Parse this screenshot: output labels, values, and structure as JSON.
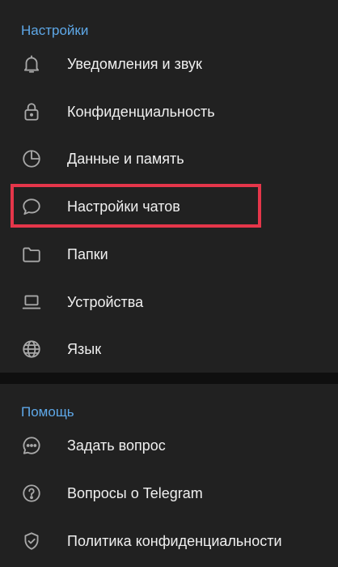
{
  "settings": {
    "header": "Настройки",
    "items": [
      {
        "label": "Уведомления и звук",
        "icon": "bell-icon"
      },
      {
        "label": "Конфиденциальность",
        "icon": "lock-icon"
      },
      {
        "label": "Данные и память",
        "icon": "pie-chart-icon"
      },
      {
        "label": "Настройки чатов",
        "icon": "chat-bubble-icon"
      },
      {
        "label": "Папки",
        "icon": "folder-icon"
      },
      {
        "label": "Устройства",
        "icon": "laptop-icon"
      },
      {
        "label": "Язык",
        "icon": "globe-icon"
      }
    ]
  },
  "help": {
    "header": "Помощь",
    "items": [
      {
        "label": "Задать вопрос",
        "icon": "chat-dots-icon"
      },
      {
        "label": "Вопросы о Telegram",
        "icon": "question-circle-icon"
      },
      {
        "label": "Политика конфиденциальности",
        "icon": "shield-check-icon"
      }
    ]
  },
  "colors": {
    "accent": "#5ea8e8",
    "highlight": "#e5364a",
    "background": "#212121",
    "separator": "#0f0f0f",
    "text": "#f0f0f0",
    "icon": "#a8a8a8"
  }
}
